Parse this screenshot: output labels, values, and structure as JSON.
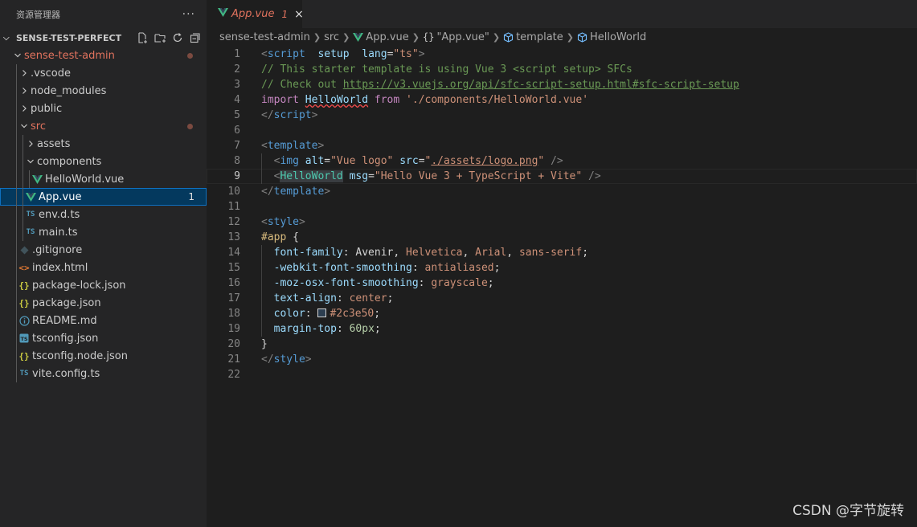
{
  "sidebar": {
    "title": "资源管理器",
    "more": "···",
    "section": "SENSE-TEST-PERFECT",
    "tree": [
      {
        "label": "sense-test-admin",
        "depth": 1,
        "kind": "folder-open",
        "modified": true
      },
      {
        "label": ".vscode",
        "depth": 2,
        "kind": "folder"
      },
      {
        "label": "node_modules",
        "depth": 2,
        "kind": "folder"
      },
      {
        "label": "public",
        "depth": 2,
        "kind": "folder"
      },
      {
        "label": "src",
        "depth": 2,
        "kind": "folder-open",
        "modified": true
      },
      {
        "label": "assets",
        "depth": 3,
        "kind": "folder"
      },
      {
        "label": "components",
        "depth": 3,
        "kind": "folder-open"
      },
      {
        "label": "HelloWorld.vue",
        "depth": 4,
        "kind": "vue"
      },
      {
        "label": "App.vue",
        "depth": 3,
        "kind": "vue",
        "selected": true,
        "badge": "1"
      },
      {
        "label": "env.d.ts",
        "depth": 3,
        "kind": "ts"
      },
      {
        "label": "main.ts",
        "depth": 3,
        "kind": "ts"
      },
      {
        "label": ".gitignore",
        "depth": 2,
        "kind": "git"
      },
      {
        "label": "index.html",
        "depth": 2,
        "kind": "html"
      },
      {
        "label": "package-lock.json",
        "depth": 2,
        "kind": "json"
      },
      {
        "label": "package.json",
        "depth": 2,
        "kind": "json"
      },
      {
        "label": "README.md",
        "depth": 2,
        "kind": "info"
      },
      {
        "label": "tsconfig.json",
        "depth": 2,
        "kind": "tsconfig"
      },
      {
        "label": "tsconfig.node.json",
        "depth": 2,
        "kind": "json"
      },
      {
        "label": "vite.config.ts",
        "depth": 2,
        "kind": "ts"
      }
    ]
  },
  "tab": {
    "name": "App.vue",
    "count": "1",
    "close": "×"
  },
  "breadcrumbs": [
    "sense-test-admin",
    "src",
    "App.vue",
    "\"App.vue\"",
    "template",
    "HelloWorld"
  ],
  "breadcrumb_curly": "{}",
  "editor": {
    "current_line": 9,
    "lines": [
      [
        [
          "t-gray",
          "<"
        ],
        [
          "t-tag",
          "script"
        ],
        [
          "",
          "  "
        ],
        [
          "t-attr",
          "setup"
        ],
        [
          "",
          "  "
        ],
        [
          "t-attr",
          "lang"
        ],
        [
          "",
          "="
        ],
        [
          "t-str",
          "\"ts\""
        ],
        [
          "t-gray",
          ">"
        ]
      ],
      [
        [
          "t-cm",
          "// This starter template is using Vue 3 <script setup> SFCs"
        ]
      ],
      [
        [
          "t-cm",
          "// Check out "
        ],
        [
          "t-url",
          "https://v3.vuejs.org/api/sfc-script-setup.html#sfc-script-setup"
        ]
      ],
      [
        [
          "t-kw",
          "import"
        ],
        [
          "",
          " "
        ],
        [
          "t-attr t-err",
          "HelloWorld"
        ],
        [
          "",
          " "
        ],
        [
          "t-kw",
          "from"
        ],
        [
          "",
          " "
        ],
        [
          "t-str",
          "'./components/HelloWorld.vue'"
        ]
      ],
      [
        [
          "t-gray",
          "</"
        ],
        [
          "t-tag",
          "script"
        ],
        [
          "t-gray",
          ">"
        ]
      ],
      [],
      [
        [
          "t-gray",
          "<"
        ],
        [
          "t-tag",
          "template"
        ],
        [
          "t-gray",
          ">"
        ]
      ],
      [
        [
          "",
          "  "
        ],
        [
          "t-gray",
          "<"
        ],
        [
          "t-tag",
          "img"
        ],
        [
          "",
          " "
        ],
        [
          "t-attr",
          "alt"
        ],
        [
          "",
          "="
        ],
        [
          "t-str",
          "\"Vue logo\""
        ],
        [
          "",
          " "
        ],
        [
          "t-attr",
          "src"
        ],
        [
          "",
          "="
        ],
        [
          "t-str",
          "\""
        ],
        [
          "t-str t-ulink",
          "./assets/logo.png"
        ],
        [
          "t-str",
          "\""
        ],
        [
          "",
          " "
        ],
        [
          "t-gray",
          "/>"
        ]
      ],
      [
        [
          "",
          "  "
        ],
        [
          "t-gray",
          "<"
        ],
        [
          "t-comp hl",
          "HelloWorld"
        ],
        [
          "",
          " "
        ],
        [
          "t-attr",
          "msg"
        ],
        [
          "",
          "="
        ],
        [
          "t-str",
          "\"Hello Vue 3 + TypeScript + Vite\""
        ],
        [
          "",
          " "
        ],
        [
          "t-gray",
          "/>"
        ]
      ],
      [
        [
          "t-gray",
          "</"
        ],
        [
          "t-tag",
          "template"
        ],
        [
          "t-gray",
          ">"
        ]
      ],
      [],
      [
        [
          "t-gray",
          "<"
        ],
        [
          "t-tag",
          "style"
        ],
        [
          "t-gray",
          ">"
        ]
      ],
      [
        [
          "t-sel",
          "#app"
        ],
        [
          "",
          " {"
        ]
      ],
      [
        [
          "",
          "  "
        ],
        [
          "t-attr",
          "font-family"
        ],
        [
          "",
          ": Avenir, "
        ],
        [
          "t-str",
          "Helvetica"
        ],
        [
          "",
          ", "
        ],
        [
          "t-str",
          "Arial"
        ],
        [
          "",
          ", "
        ],
        [
          "t-str",
          "sans-serif"
        ],
        [
          "",
          ";"
        ]
      ],
      [
        [
          "",
          "  "
        ],
        [
          "t-attr",
          "-webkit-font-smoothing"
        ],
        [
          "",
          ": "
        ],
        [
          "t-str",
          "antialiased"
        ],
        [
          "",
          ";"
        ]
      ],
      [
        [
          "",
          "  "
        ],
        [
          "t-attr",
          "-moz-osx-font-smoothing"
        ],
        [
          "",
          ": "
        ],
        [
          "t-str",
          "grayscale"
        ],
        [
          "",
          ";"
        ]
      ],
      [
        [
          "",
          "  "
        ],
        [
          "t-attr",
          "text-align"
        ],
        [
          "",
          ": "
        ],
        [
          "t-str",
          "center"
        ],
        [
          "",
          ";"
        ]
      ],
      [
        [
          "",
          "  "
        ],
        [
          "t-attr",
          "color"
        ],
        [
          "",
          ": "
        ],
        [
          "swatch",
          ""
        ],
        [
          "t-str",
          "#2c3e50"
        ],
        [
          "",
          ";"
        ]
      ],
      [
        [
          "",
          "  "
        ],
        [
          "t-attr",
          "margin-top"
        ],
        [
          "",
          ": "
        ],
        [
          "t-num",
          "60px"
        ],
        [
          "",
          ";"
        ]
      ],
      [
        [
          "",
          "}"
        ]
      ],
      [
        [
          "t-gray",
          "</"
        ],
        [
          "t-tag",
          "style"
        ],
        [
          "t-gray",
          ">"
        ]
      ],
      []
    ]
  },
  "watermark": "CSDN @字节旋转",
  "colors": {
    "vue": "#41b883",
    "ts": "#519aba",
    "modified": "#e2735e",
    "selection": "#04395e"
  }
}
